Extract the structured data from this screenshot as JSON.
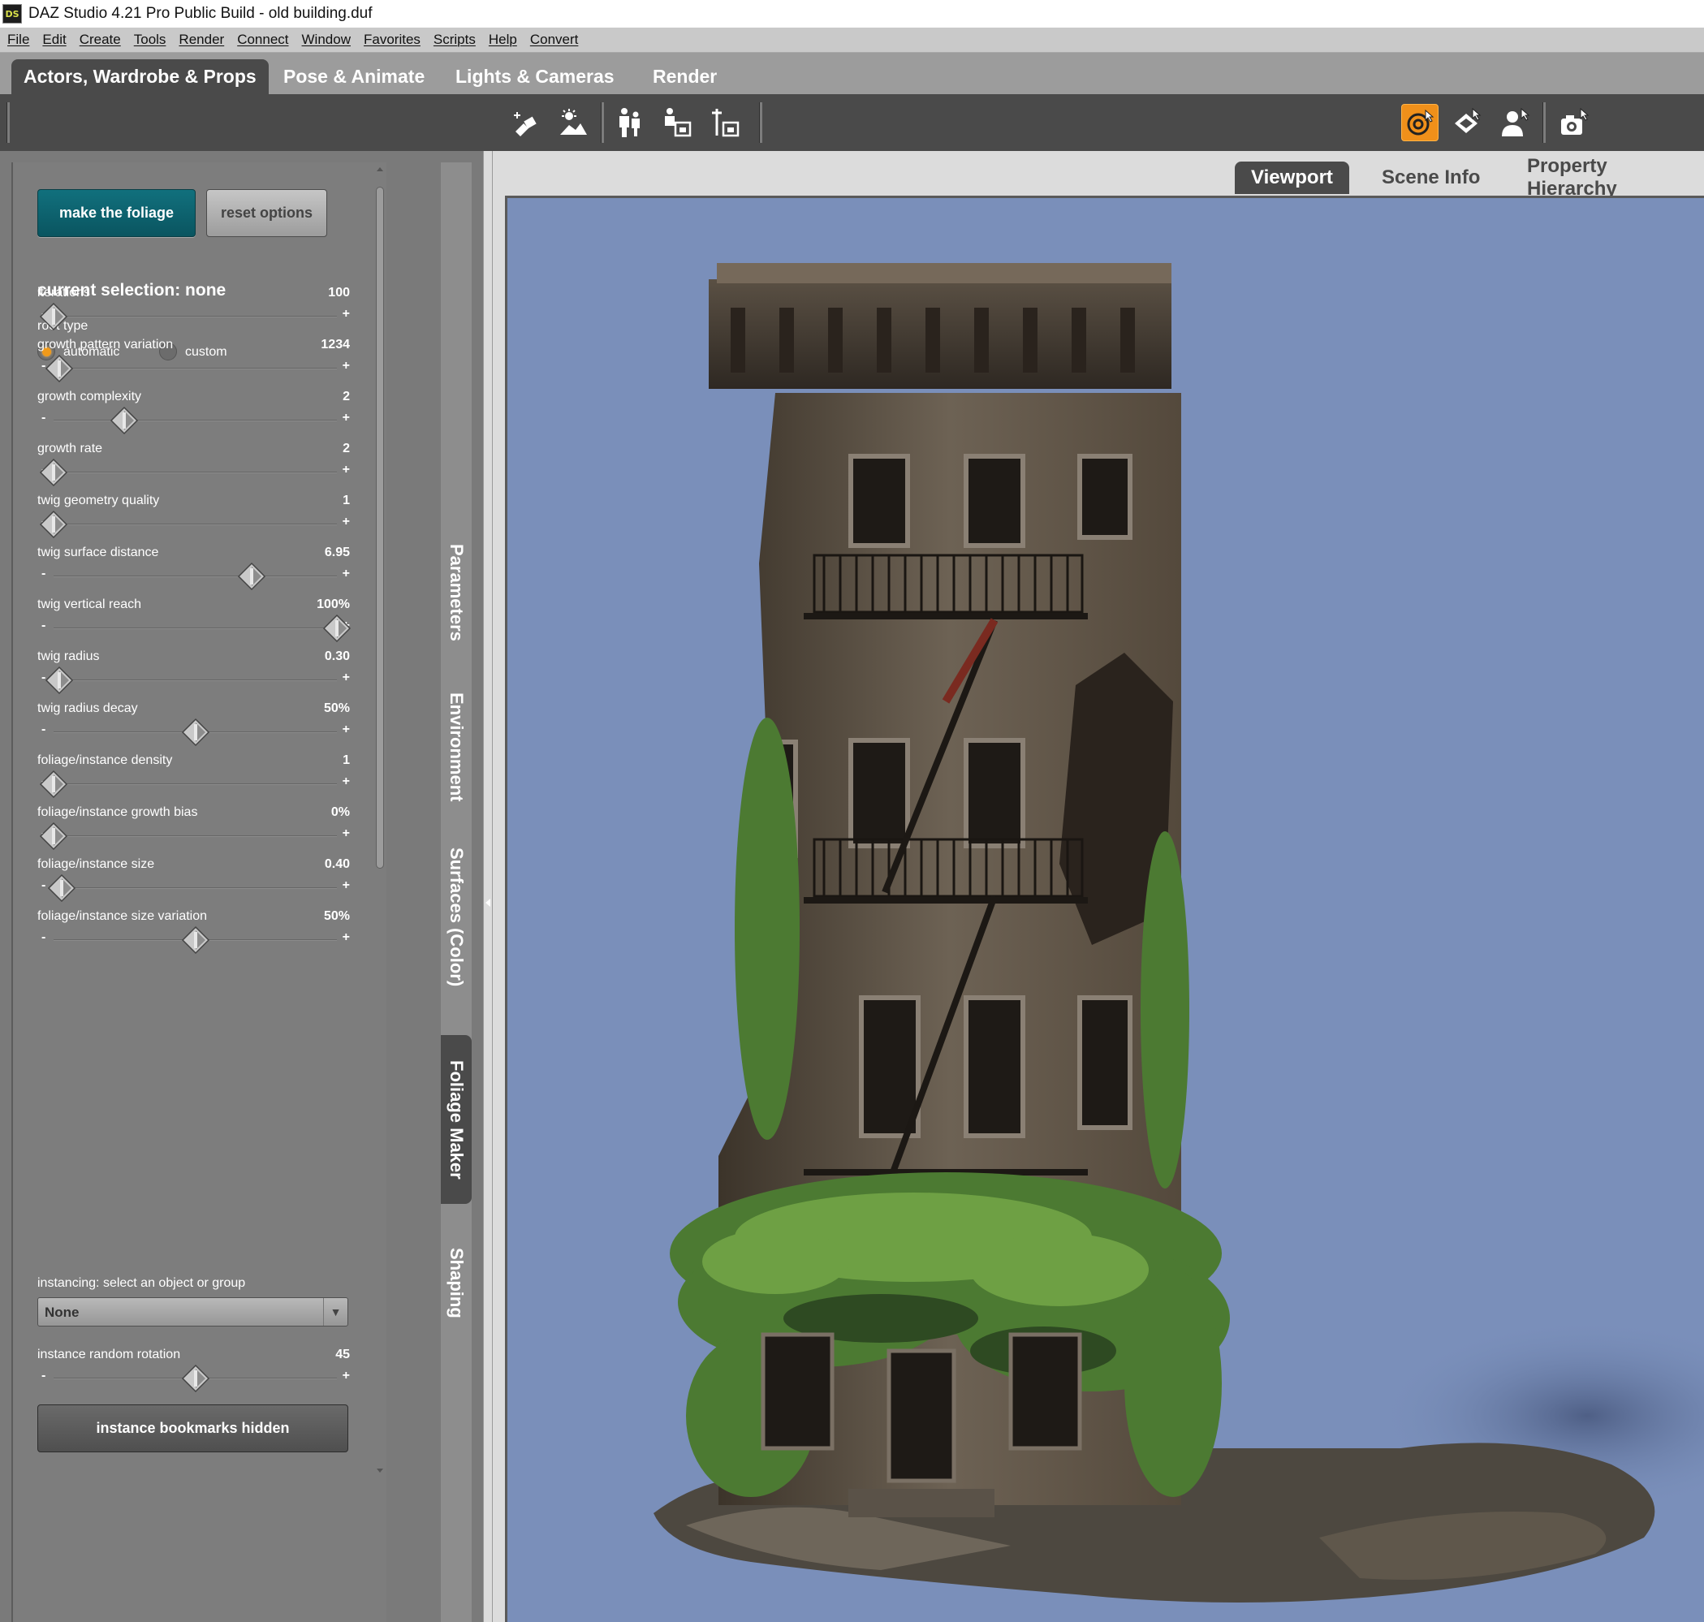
{
  "window": {
    "logo_text": "DS",
    "title": "DAZ Studio 4.21 Pro Public Build - old building.duf"
  },
  "menu": [
    "File",
    "Edit",
    "Create",
    "Tools",
    "Render",
    "Connect",
    "Window",
    "Favorites",
    "Scripts",
    "Help",
    "Convert"
  ],
  "main_tabs": [
    {
      "label": "Actors, Wardrobe & Props",
      "active": true
    },
    {
      "label": "Pose & Animate",
      "active": false
    },
    {
      "label": "Lights & Cameras",
      "active": false
    },
    {
      "label": "Render",
      "active": false
    }
  ],
  "toolbar": {
    "icons": [
      "create-prop-icon",
      "environment-icon",
      "pose-figure-icon",
      "load-scene-icon",
      "measure-icon"
    ],
    "right_icons": [
      "universal-tool-icon",
      "transform-tool-icon",
      "figure-select-icon",
      "camera-tool-icon"
    ],
    "accent_color": "#f0901a"
  },
  "foliage_panel": {
    "make_button": "make the foliage",
    "reset_button": "reset options",
    "current_selection": "current selection: none",
    "root_type": {
      "label": "root type",
      "options": [
        {
          "label": "automatic",
          "selected": true
        },
        {
          "label": "custom",
          "selected": false
        }
      ]
    },
    "sliders": [
      {
        "name": "iterations",
        "value": "100",
        "level": 0.0
      },
      {
        "name": "growth pattern variation",
        "value": "1234",
        "level": 0.02
      },
      {
        "name": "growth complexity",
        "value": "2",
        "level": 0.25
      },
      {
        "name": "growth rate",
        "value": "2",
        "level": 0.0
      },
      {
        "name": "twig geometry quality",
        "value": "1",
        "level": 0.0
      },
      {
        "name": "twig surface distance",
        "value": "6.95",
        "level": 0.7
      },
      {
        "name": "twig vertical reach",
        "value": "100%",
        "level": 1.0
      },
      {
        "name": "twig radius",
        "value": "0.30",
        "level": 0.02
      },
      {
        "name": "twig radius decay",
        "value": "50%",
        "level": 0.5
      },
      {
        "name": "foliage/instance density",
        "value": "1",
        "level": 0.0
      },
      {
        "name": "foliage/instance growth bias",
        "value": "0%",
        "level": 0.0
      },
      {
        "name": "foliage/instance size",
        "value": "0.40",
        "level": 0.03
      },
      {
        "name": "foliage/instance size variation",
        "value": "50%",
        "level": 0.5
      }
    ],
    "instancing_label": "instancing: select an object or group",
    "instancing_value": "None",
    "rotation_slider": {
      "name": "instance random rotation",
      "value": "45",
      "level": 0.5
    },
    "bookmarks_button": "instance bookmarks hidden"
  },
  "side_tabs": [
    {
      "label": "Parameters",
      "active": false
    },
    {
      "label": "Environment",
      "active": false
    },
    {
      "label": "Surfaces (Color)",
      "active": false
    },
    {
      "label": "Foliage Maker",
      "active": true
    },
    {
      "label": "Shaping",
      "active": false
    }
  ],
  "viewport_tabs": [
    {
      "label": "Viewport",
      "active": true
    },
    {
      "label": "Scene Info",
      "active": false
    },
    {
      "label": "Property Hierarchy",
      "active": false
    }
  ],
  "viewport": {
    "background_color": "#7a8fba",
    "scene": "old-building-with-foliage"
  }
}
